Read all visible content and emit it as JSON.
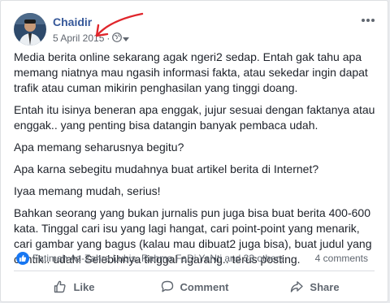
{
  "post": {
    "author": "Chaidir",
    "date": "5 April 2015",
    "privacy_icon": "globe-icon",
    "paragraphs": [
      "Media berita online sekarang agak ngeri2 sedap. Entah gak tahu apa memang niatnya mau ngasih informasi fakta, atau sekedar ingin dapat trafik atau cuman mikirin penghasilan yang tinggi doang.",
      "Entah itu isinya beneran apa enggak, jujur sesuai dengan faktanya atau enggak.. yang penting bisa datangin banyak pembaca udah.",
      "Apa memang seharusnya begitu?",
      "Apa karna sebegitu mudahnya buat artikel berita di Internet?",
      "Iyaa memang mudah, serius!",
      "Bahkan seorang yang bukan jurnalis pun juga bisa buat berita 400-600 kata. Tinggal cari isu yang lagi hangat, cari point-point yang menarik, cari gambar yang bagus (kalau mau dibuat2 juga bisa), buat judul yang cantik.. udah! Selebihnya tinggal ngarang.. terus posting."
    ]
  },
  "reactions": {
    "names": "Fatimah Az-Zahra Lubis, Rahma FaDi YaNti and 33 others",
    "comments": "4 comments"
  },
  "actions": {
    "like": "Like",
    "comment": "Comment",
    "share": "Share"
  },
  "colors": {
    "author_link": "#365899",
    "like_blue": "#1877f2",
    "annotation_red": "#e0262c"
  }
}
